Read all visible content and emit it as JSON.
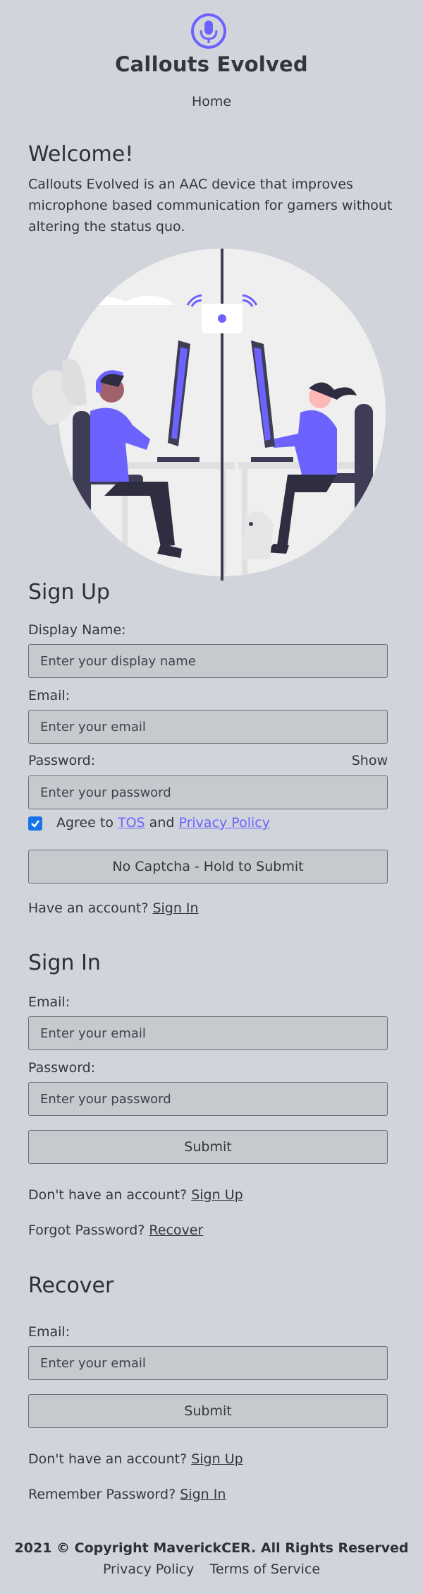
{
  "header": {
    "brand": "Callouts Evolved",
    "nav_home": "Home",
    "logo_icon": "microphone-icon",
    "accent_color": "#6c63ff"
  },
  "welcome": {
    "title": "Welcome!",
    "text": "Callouts Evolved is an AAC device that improves microphone based communication for gamers without altering the status quo."
  },
  "signup": {
    "title": "Sign Up",
    "display_name_label": "Display Name:",
    "display_name_placeholder": "Enter your display name",
    "email_label": "Email:",
    "email_placeholder": "Enter your email",
    "password_label": "Password:",
    "password_toggle": "Show",
    "password_placeholder": "Enter your password",
    "agree_prefix": "Agree to",
    "tos_link": "TOS",
    "and": "and",
    "privacy_link": "Privacy Policy",
    "agree_checked": true,
    "submit": "No Captcha - Hold to Submit",
    "have_account": "Have an account?",
    "sign_in_link": "Sign In"
  },
  "signin": {
    "title": "Sign In",
    "email_label": "Email:",
    "email_placeholder": "Enter your email",
    "password_label": "Password:",
    "password_placeholder": "Enter your password",
    "submit": "Submit",
    "no_account": "Don't have an account?",
    "sign_up_link": "Sign Up",
    "forgot": "Forgot Password?",
    "recover_link": "Recover"
  },
  "recover": {
    "title": "Recover",
    "email_label": "Email:",
    "email_placeholder": "Enter your email",
    "submit": "Submit",
    "no_account": "Don't have an account?",
    "sign_up_link": "Sign Up",
    "remember": "Remember Password?",
    "sign_in_link": "Sign In"
  },
  "footer": {
    "copyright": "2021 © Copyright MaverickCER. All Rights Reserved",
    "privacy": "Privacy Policy",
    "terms": "Terms of Service"
  }
}
